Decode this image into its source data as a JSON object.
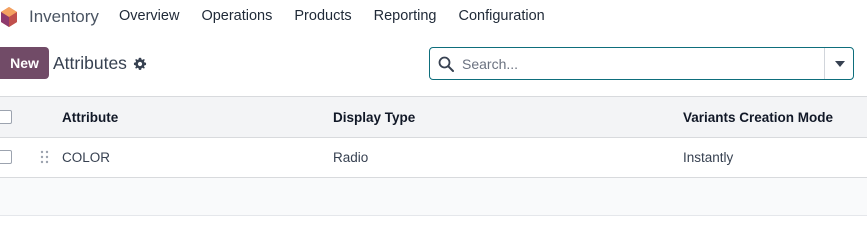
{
  "app": {
    "name": "Inventory",
    "logo_icon": "odoo-inventory-logo-icon"
  },
  "nav": {
    "items": [
      {
        "label": "Overview"
      },
      {
        "label": "Operations"
      },
      {
        "label": "Products"
      },
      {
        "label": "Reporting"
      },
      {
        "label": "Configuration"
      }
    ]
  },
  "control_panel": {
    "new_label": "New",
    "title": "Attributes",
    "settings_icon": "gear-icon"
  },
  "search": {
    "placeholder": "Search...",
    "value": "",
    "icon": "search-icon",
    "toggle_icon": "caret-down-icon"
  },
  "table": {
    "columns": [
      "Attribute",
      "Display Type",
      "Variants Creation Mode"
    ],
    "rows": [
      {
        "attribute": "COLOR",
        "display_type": "Radio",
        "creation_mode": "Instantly"
      }
    ]
  },
  "colors": {
    "primary": "#714b67",
    "search_border": "#0e6e7c",
    "header_bg": "#f3f4f6"
  }
}
